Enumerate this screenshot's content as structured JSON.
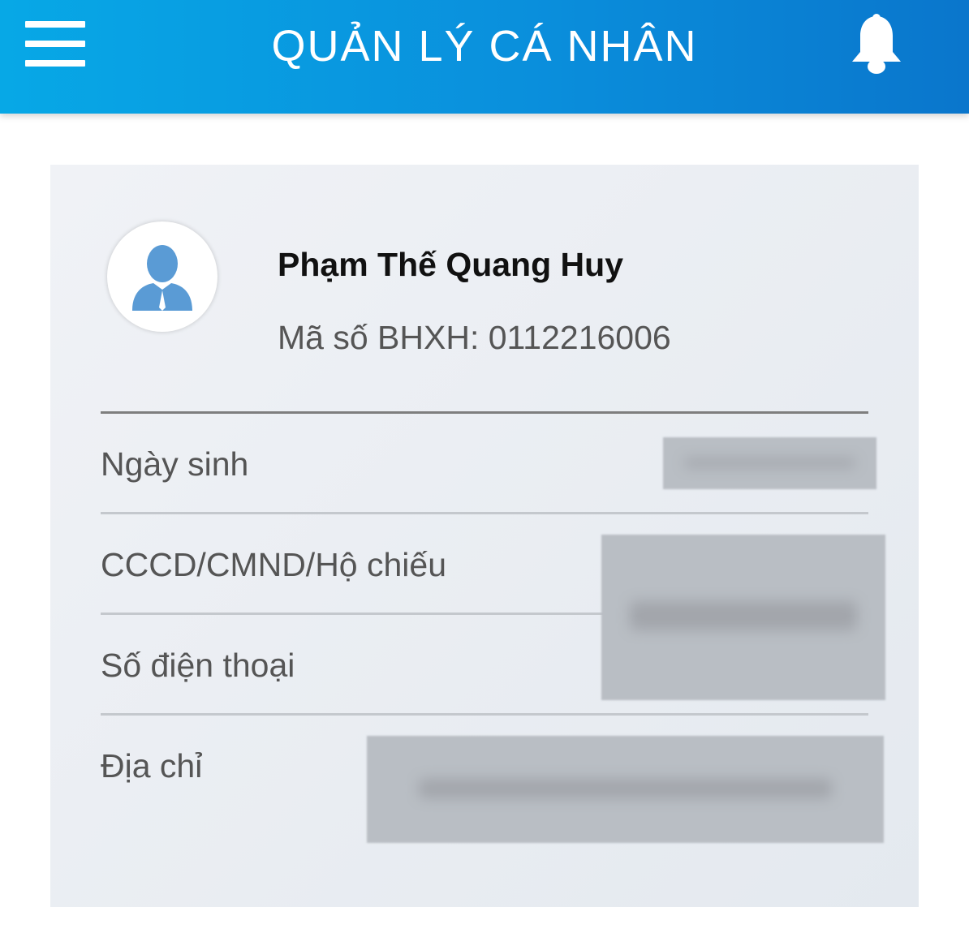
{
  "header": {
    "title": "QUẢN LÝ CÁ NHÂN",
    "menu_icon": "menu-icon",
    "bell_icon": "bell-icon",
    "accent_color": "#0a8fdc"
  },
  "profile": {
    "name": "Phạm Thế Quang Huy",
    "bhxh": "Mã số BHXH: 0112216006",
    "avatar_icon": "user-avatar-icon"
  },
  "fields": {
    "dob_label": "Ngày sinh",
    "id_label": "CCCD/CMND/Hộ chiếu",
    "phone_label": "Số điện thoại",
    "address_label": "Địa chỉ"
  }
}
